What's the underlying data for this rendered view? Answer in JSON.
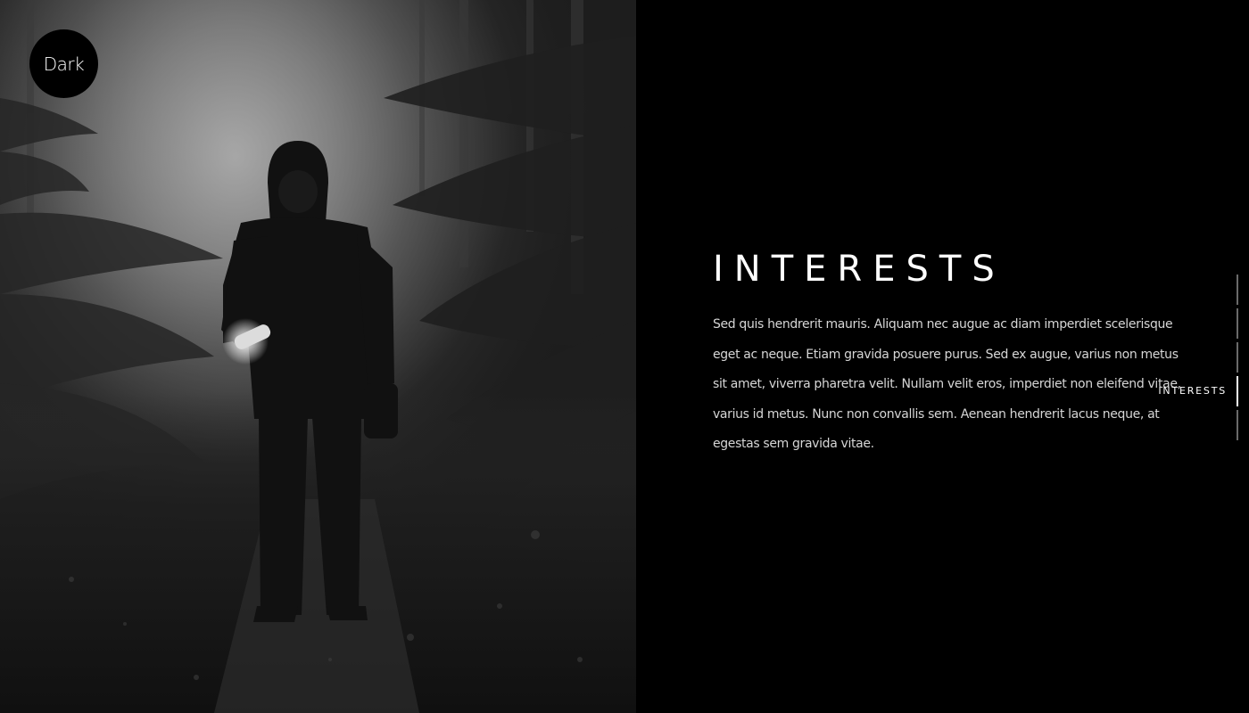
{
  "brand": {
    "logo_text": "Dark"
  },
  "section": {
    "title": "INTERESTS",
    "body": "Sed quis hendrerit mauris. Aliquam nec augue ac diam imperdiet scelerisque eget ac neque. Etiam gravida posuere purus. Sed ex augue, varius non metus sit amet, viverra pharetra velit. Nullam velit eros, imperdiet non eleifend vitae, varius id metus. Nunc non convallis sem. Aenean hendrerit lacus neque, at egestas sem gravida vitae."
  },
  "side_nav": {
    "active_label": "INTERESTS",
    "items": [
      {
        "active": false
      },
      {
        "active": false
      },
      {
        "active": false
      },
      {
        "active": true
      },
      {
        "active": false
      }
    ]
  },
  "colors": {
    "background": "#000000",
    "text": "#ffffff",
    "body_text": "#d6d6d6",
    "nav_inactive": "#6a6a6a",
    "nav_active": "#ffffff"
  },
  "photo": {
    "subject": "hooded-person-with-flashlight-in-foggy-forest"
  }
}
